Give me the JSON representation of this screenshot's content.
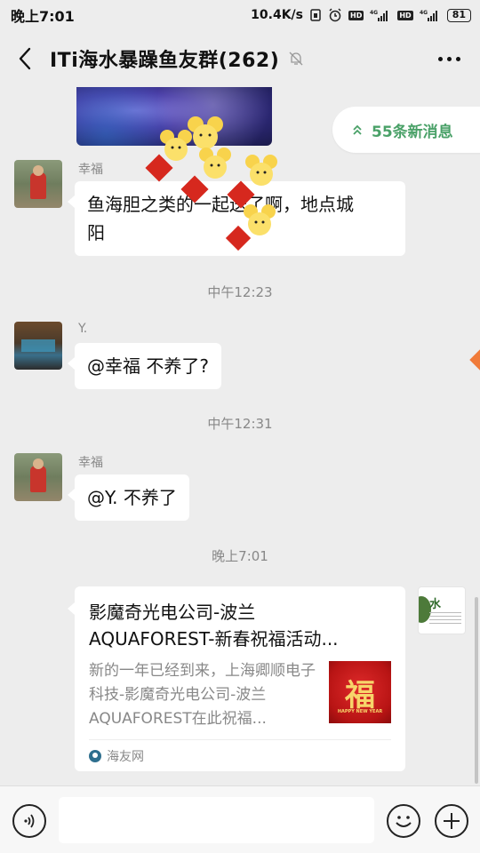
{
  "status_bar": {
    "time": "晚上7:01",
    "net_speed": "10.4K/s",
    "hd_label": "HD",
    "network_type": "4G",
    "battery": "81"
  },
  "header": {
    "title": "ITi海水暴躁鱼友群(262)",
    "back_icon": "chevron-left-icon",
    "mute_icon": "bell-off-icon",
    "more_icon": "more-dots-icon"
  },
  "new_messages_pill": {
    "label": "55条新消息",
    "icon": "double-chevron-up-icon",
    "color": "#4aa168"
  },
  "messages": [
    {
      "sender": "幸福",
      "text_line1": "鱼海胆之类的一起送了啊，地点城",
      "text_line2": "阳"
    },
    {
      "time": "中午12:23"
    },
    {
      "sender": "Y.",
      "text": "@幸福  不养了?"
    },
    {
      "time": "中午12:31"
    },
    {
      "sender": "幸福",
      "text": "@Y.  不养了"
    },
    {
      "time": "晚上7:01"
    }
  ],
  "link_card": {
    "title_line1": "影魔奇光电公司-波兰",
    "title_line2": "AQUAFOREST-新春祝福活动...",
    "desc": "新的一年已经到来，上海卿顺电子科技-影魔奇光电公司-波兰AQUAFOREST在此祝福...",
    "thumb_char": "福",
    "thumb_caption": "HAPPY NEW YEAR",
    "source": "海友网"
  },
  "right_peek": {
    "char": "水"
  },
  "input_bar": {
    "voice_icon": "voice-icon",
    "emoji_icon": "emoji-icon",
    "plus_icon": "plus-icon",
    "input_value": ""
  }
}
